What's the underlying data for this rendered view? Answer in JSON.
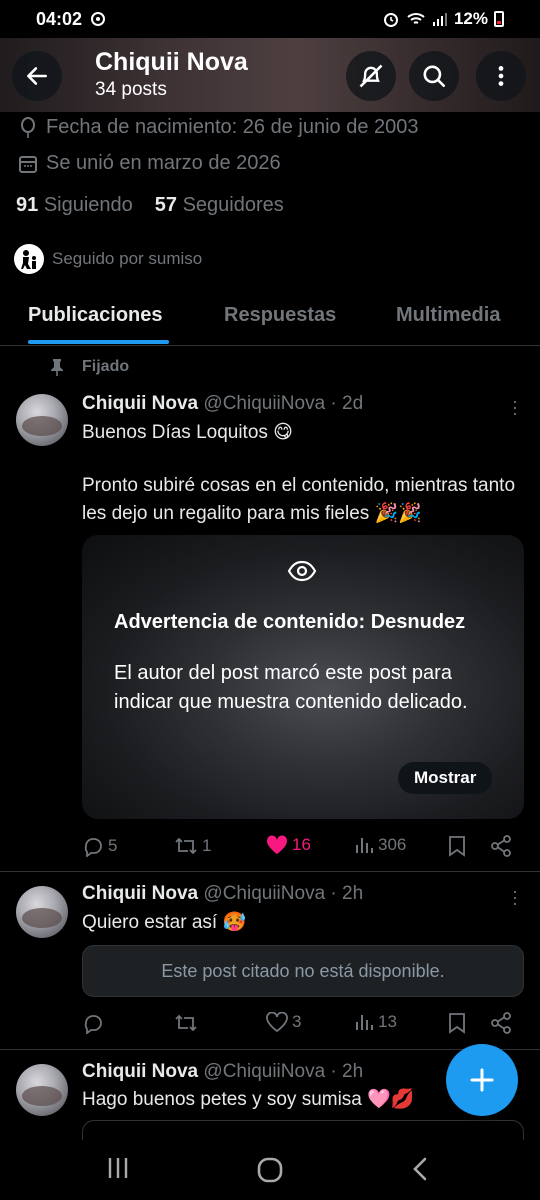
{
  "status_bar": {
    "time": "04:02",
    "battery": "12%"
  },
  "header": {
    "name": "Chiquii Nova",
    "posts_count": "34 posts",
    "back_icon": "arrow-left-icon",
    "notify_icon": "bell-off-icon",
    "search_icon": "search-icon",
    "more_icon": "more-vertical-icon"
  },
  "profile": {
    "birthday": "Fecha de nacimiento: 26 de junio de 2003",
    "joined": "Se unió en marzo de 2026",
    "following_count": "91",
    "following_label": "Siguiendo",
    "followers_count": "57",
    "followers_label": "Seguidores",
    "followed_by": "Seguido por sumiso"
  },
  "tabs": [
    {
      "label": "Publicaciones",
      "active": true
    },
    {
      "label": "Respuestas",
      "active": false
    },
    {
      "label": "Multimedia",
      "active": false
    }
  ],
  "posts": [
    {
      "pinned_label": "Fijado",
      "name": "Chiquii Nova",
      "handle_time": "@ChiquiiNova · 2d",
      "line1": "Buenos Días Loquitos 😋",
      "line2": "Pronto subiré cosas en el contenido, mientras tanto les dejo un regalito para mis fieles 🎉🎉",
      "media_warning": {
        "title": "Advertencia de contenido: Desnudez",
        "body": "El autor del post marcó este post para indicar que muestra contenido delicado.",
        "button": "Mostrar"
      },
      "replies": "5",
      "reposts": "1",
      "likes": "16",
      "views": "306"
    },
    {
      "name": "Chiquii Nova",
      "handle_time": "@ChiquiiNova · 2h",
      "text": "Quiero estar así 🥵",
      "quote_unavailable": "Este post citado no está disponible.",
      "replies": "",
      "reposts": "",
      "likes": "3",
      "views": "13"
    },
    {
      "name": "Chiquii Nova",
      "handle_time": "@ChiquiiNova · 2h",
      "text": "Hago buenos petes y soy sumisa 🩷💋"
    }
  ],
  "colors": {
    "accent": "#1d9bf0",
    "like": "#f91880",
    "muted": "#71767b",
    "background": "#000000"
  }
}
